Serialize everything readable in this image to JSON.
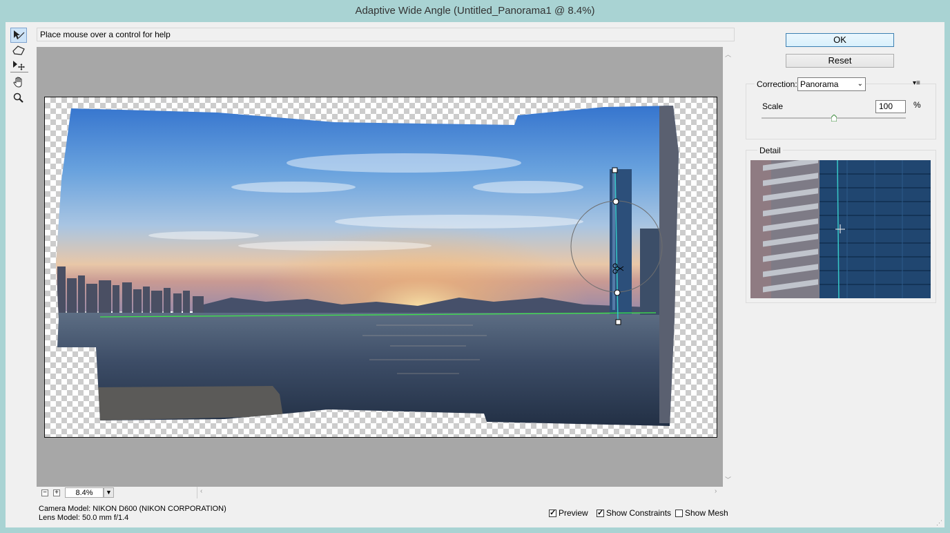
{
  "window": {
    "title": "Adaptive Wide Angle (Untitled_Panorama1 @ 8.4%)"
  },
  "help_text": "Place mouse over a control for help",
  "tools": [
    {
      "name": "constraint-tool-icon",
      "active": true
    },
    {
      "name": "polygon-constraint-tool-icon",
      "active": false
    },
    {
      "name": "move-tool-icon",
      "active": false
    },
    {
      "name": "hand-tool-icon",
      "active": false
    },
    {
      "name": "zoom-tool-icon",
      "active": false
    }
  ],
  "zoom": {
    "value": "8.4%",
    "minus": "−",
    "plus": "+"
  },
  "info": {
    "camera": "Camera Model: NIKON D600 (NIKON CORPORATION)",
    "lens": "Lens Model: 50.0 mm f/1.4"
  },
  "options": {
    "preview": {
      "label": "Preview",
      "checked": true
    },
    "constraints": {
      "label": "Show Constraints",
      "checked": true
    },
    "mesh": {
      "label": "Show Mesh",
      "checked": false
    }
  },
  "buttons": {
    "ok": "OK",
    "reset": "Reset"
  },
  "correction": {
    "label": "Correction:",
    "value": "Panorama"
  },
  "scale": {
    "label": "Scale",
    "value": "100",
    "unit": "%",
    "slider_fraction": 0.5
  },
  "detail": {
    "label": "Detail"
  },
  "colors": {
    "accent": "#3c7fb1",
    "constraint_line": "#33dd33",
    "vertical_constraint": "#37c8c8"
  }
}
